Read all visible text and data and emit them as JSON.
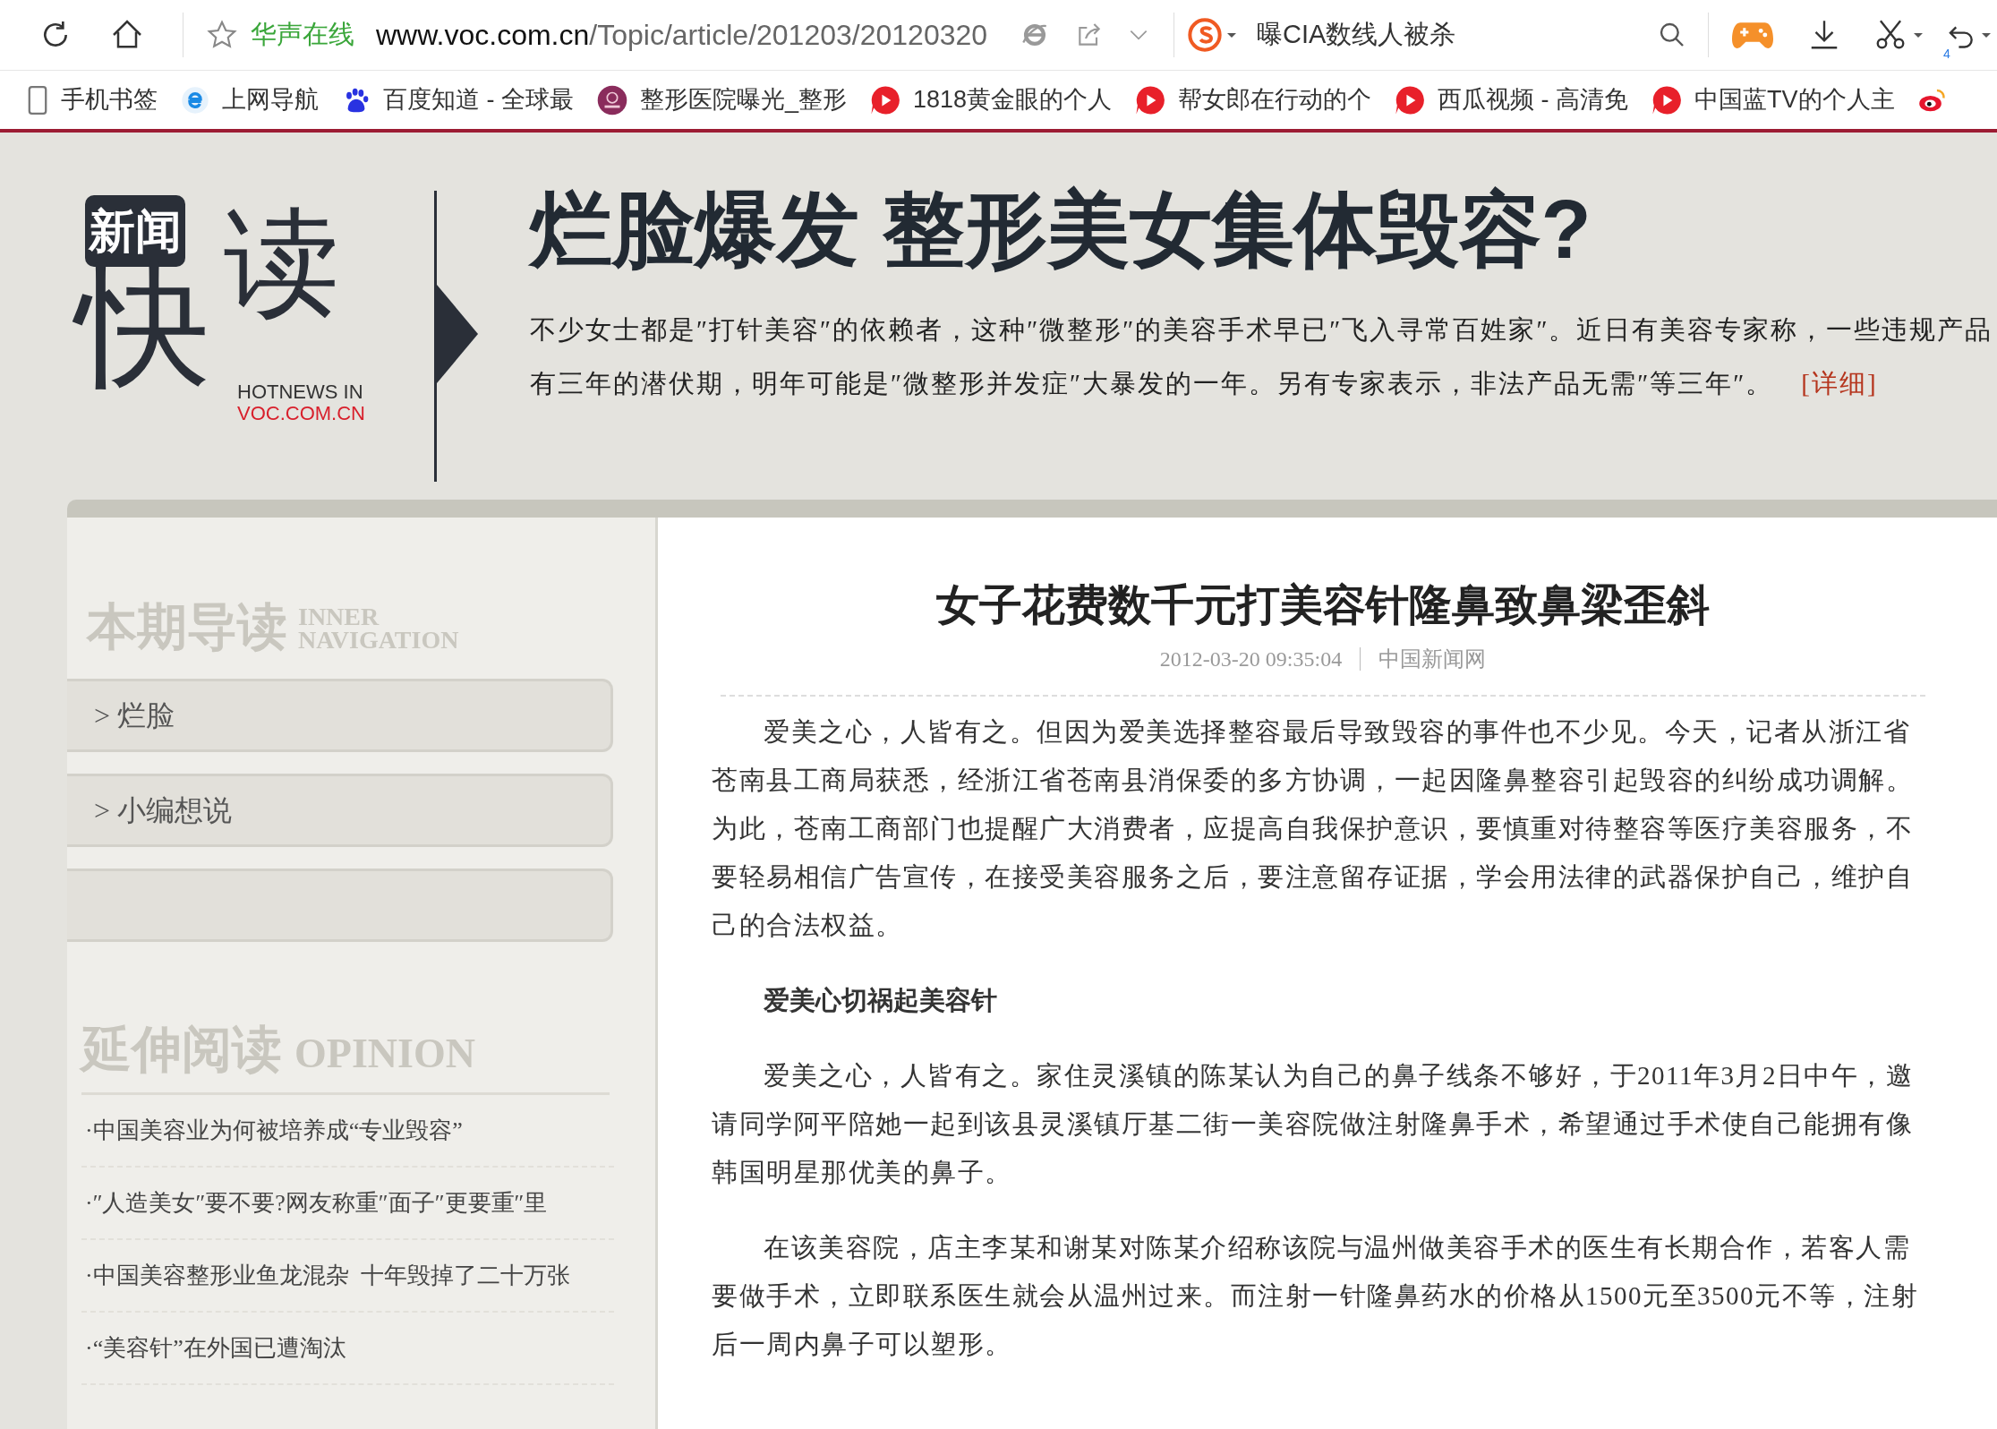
{
  "browser": {
    "site_name": "华声在线",
    "url_domain": "www.voc.com.cn",
    "url_path": "/Topic/article/201203/20120320",
    "search_text": "曝CIA数线人被杀",
    "undo_count": "4"
  },
  "bookmarks": [
    {
      "label": "手机书签",
      "kind": "phone"
    },
    {
      "label": "上网导航",
      "kind": "ie"
    },
    {
      "label": "百度知道 - 全球最",
      "kind": "paw"
    },
    {
      "label": "整形医院曝光_整形",
      "kind": "badge"
    },
    {
      "label": "1818黄金眼的个人",
      "kind": "play"
    },
    {
      "label": "帮女郎在行动的个",
      "kind": "play"
    },
    {
      "label": "西瓜视频 - 高清免",
      "kind": "play"
    },
    {
      "label": "中国蓝TV的个人主",
      "kind": "play"
    },
    {
      "kind": "weibo"
    }
  ],
  "header": {
    "logo": {
      "top": "新闻",
      "left": "快",
      "right": "读",
      "tag1": "HOTNEWS IN",
      "tag2": "VOC.COM.CN"
    },
    "headline": "烂脸爆发 整形美女集体毁容?",
    "summary": "不少女士都是″打针美容″的依赖者，这种″微整形″的美容手术早已″飞入寻常百姓家″。近日有美容专家称，一些违规产品有三年的潜伏期，明年可能是″微整形并发症″大暴发的一年。另有专家表示，非法产品无需″等三年″。",
    "more_link": "[详细]"
  },
  "sidebar": {
    "nav_title": "本期导读",
    "nav_title_en_1": "INNER",
    "nav_title_en_2": "NAVIGATION",
    "nav_items": [
      {
        "label": "> 烂脸"
      },
      {
        "label": "> 小编想说"
      }
    ],
    "reading_title": "延伸阅读",
    "reading_title_en": "OPINION",
    "reading_links": [
      "·中国美容业为何被培养成“专业毁容”",
      "·″人造美女″要不要?网友称重″面子″更要重″里",
      "·中国美容整形业鱼龙混杂  十年毁掉了二十万张",
      "·“美容针”在外国已遭淘汰"
    ]
  },
  "article": {
    "title": "女子花费数千元打美容针隆鼻致鼻梁歪斜",
    "date": "2012-03-20 09:35:04",
    "source": "中国新闻网",
    "blocks": [
      {
        "kind": "paragraph",
        "text": "爱美之心，人皆有之。但因为爱美选择整容最后导致毁容的事件也不少见。今天，记者从浙江省苍南县工商局获悉，经浙江省苍南县消保委的多方协调，一起因隆鼻整容引起毁容的纠纷成功调解。为此，苍南工商部门也提醒广大消费者，应提高自我保护意识，要慎重对待整容等医疗美容服务，不要轻易相信广告宣传，在接受美容服务之后，要注意留存证据，学会用法律的武器保护自己，维护自己的合法权益。"
      },
      {
        "kind": "subheading",
        "text": "爱美心切祸起美容针"
      },
      {
        "kind": "paragraph",
        "text": "爱美之心，人皆有之。家住灵溪镇的陈某认为自己的鼻子线条不够好，于2011年3月2日中午，邀请同学阿平陪她一起到该县灵溪镇厅基二街一美容院做注射隆鼻手术，希望通过手术使自己能拥有像韩国明星那优美的鼻子。"
      },
      {
        "kind": "paragraph",
        "text": "在该美容院，店主李某和谢某对陈某介绍称该院与温州做美容手术的医生有长期合作，若客人需要做手术，立即联系医生就会从温州过来。而注射一针隆鼻药水的价格从1500元至3500元不等，注射后一周内鼻子可以塑形。"
      }
    ]
  }
}
